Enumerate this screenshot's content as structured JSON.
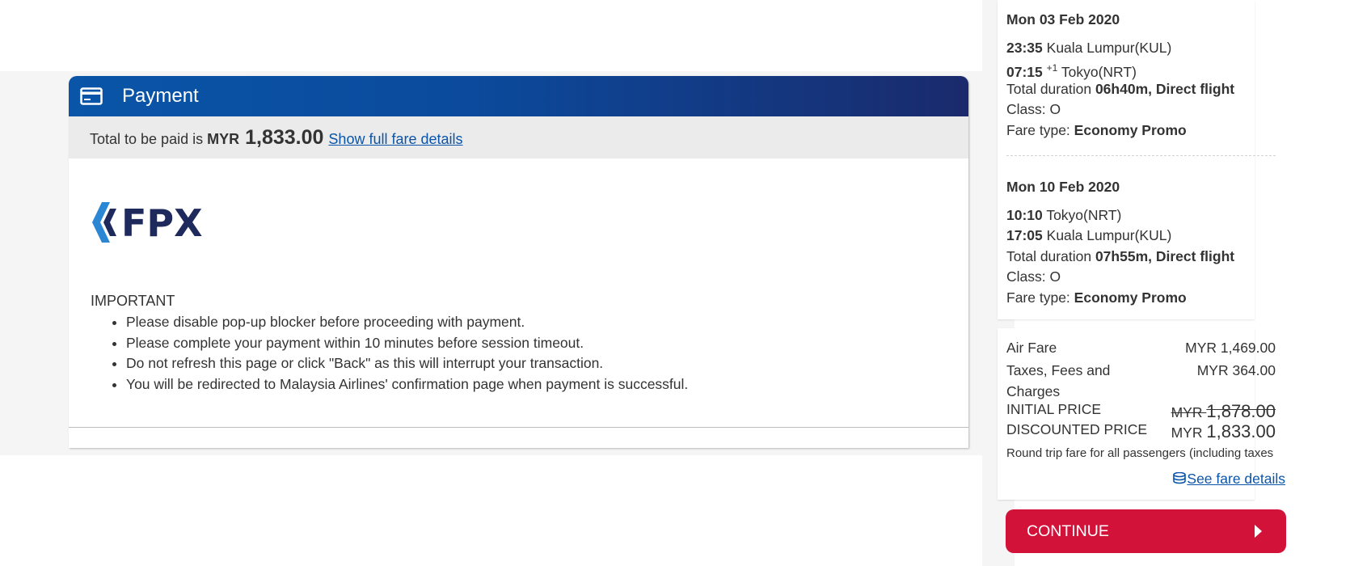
{
  "payment": {
    "title": "Payment",
    "total_prefix": "Total to be paid is",
    "currency": "MYR",
    "amount": "1,833.00",
    "fare_link": "Show full fare details",
    "logo_text": "FPX",
    "important_heading": "IMPORTANT",
    "important_items": [
      "Please disable pop-up blocker before proceeding with payment.",
      "Please complete your payment within 10 minutes before session timeout.",
      "Do not refresh this page or click \"Back\" as this will interrupt your transaction.",
      "You will be redirected to Malaysia Airlines' confirmation page when payment is successful."
    ]
  },
  "itinerary": {
    "outbound": {
      "date": "Mon 03 Feb 2020",
      "dep_time": "23:35",
      "dep_place": "Kuala Lumpur(KUL)",
      "arr_time": "07:15",
      "arr_offset": "+1",
      "arr_place": "Tokyo(NRT)",
      "duration_label": "Total duration",
      "duration_value": "06h40m, Direct flight",
      "class_label": "Class:",
      "class_value": "O",
      "fare_type_label": "Fare type:",
      "fare_type_value": "Economy Promo"
    },
    "inbound": {
      "date": "Mon 10 Feb 2020",
      "dep_time": "10:10",
      "dep_place": "Tokyo(NRT)",
      "arr_time": "17:05",
      "arr_place": "Kuala Lumpur(KUL)",
      "duration_label": "Total duration",
      "duration_value": "07h55m, Direct flight",
      "class_label": "Class:",
      "class_value": "O",
      "fare_type_label": "Fare type:",
      "fare_type_value": "Economy Promo"
    }
  },
  "fare": {
    "air_fare_label": "Air Fare",
    "air_fare_value": "MYR 1,469.00",
    "taxes_label_1": "Taxes, Fees and",
    "taxes_label_2": "Charges",
    "taxes_value": "MYR 364.00",
    "initial_label": "INITIAL PRICE",
    "initial_currency": "MYR",
    "initial_value": "1,878.00",
    "discounted_label": "DISCOUNTED PRICE",
    "discounted_currency": "MYR",
    "discounted_value": "1,833.00",
    "note": "Round trip fare for all passengers (including taxes",
    "see_fare_link": "See fare details"
  },
  "continue_label": "CONTINUE",
  "colors": {
    "header_start": "#0a55a8",
    "header_end": "#1a2a6c",
    "link": "#0a55a8",
    "continue_bg": "#d3123a",
    "fpx_blue": "#1f2a5c",
    "fpx_light_blue": "#2b86d4"
  }
}
